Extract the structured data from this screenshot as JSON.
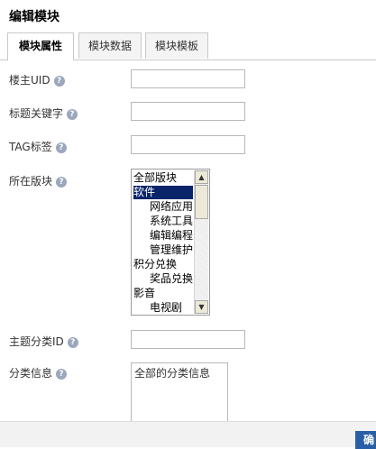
{
  "title": "编辑模块",
  "tabs": [
    {
      "label": "模块属性",
      "active": true
    },
    {
      "label": "模块数据",
      "active": false
    },
    {
      "label": "模块模板",
      "active": false
    }
  ],
  "help_glyph": "?",
  "fields": {
    "owner_uid": {
      "label": "楼主UID",
      "value": ""
    },
    "title_keyword": {
      "label": "标题关键字",
      "value": ""
    },
    "tag": {
      "label": "TAG标签",
      "value": ""
    },
    "section": {
      "label": "所在版块"
    },
    "thread_type_id": {
      "label": "主题分类ID",
      "value": ""
    },
    "sort_info": {
      "label": "分类信息",
      "value": "全部的分类信息"
    }
  },
  "section_options": [
    {
      "label": "全部版块",
      "indent": 0,
      "selected": false
    },
    {
      "label": "软件",
      "indent": 0,
      "selected": true
    },
    {
      "label": "网络应用",
      "indent": 2,
      "selected": false
    },
    {
      "label": "系统工具",
      "indent": 2,
      "selected": false
    },
    {
      "label": "编辑编程",
      "indent": 2,
      "selected": false
    },
    {
      "label": "管理维护",
      "indent": 2,
      "selected": false
    },
    {
      "label": "积分兑换",
      "indent": 0,
      "selected": false
    },
    {
      "label": "奖品兑换",
      "indent": 2,
      "selected": false
    },
    {
      "label": "影音",
      "indent": 0,
      "selected": false
    },
    {
      "label": "电视剧",
      "indent": 2,
      "selected": false
    }
  ],
  "footer": {
    "confirm_label": "确定"
  },
  "colors": {
    "selected_bg": "#0a246a",
    "confirm_bg": "#2a5fa5",
    "help_bg": "#9aa7bd"
  }
}
